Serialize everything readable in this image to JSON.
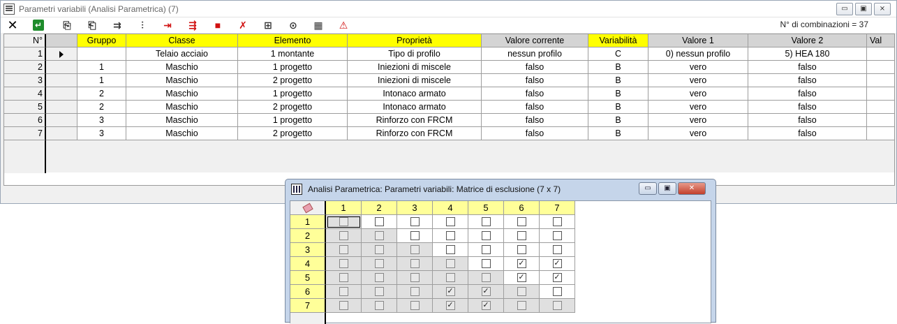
{
  "main_window": {
    "title": "Parametri variabili (Analisi Parametrica) (7)",
    "buttons": {
      "minimize": "▭",
      "restore": "▣",
      "close": "⨯"
    },
    "combinations_label": "N° di combinazioni = 37"
  },
  "toolbar": [
    {
      "icon": "close-icon",
      "glyph": "✕"
    },
    {
      "icon": "confirm-icon",
      "glyph": "↵"
    },
    {
      "icon": "copy-icon",
      "glyph": "⎘"
    },
    {
      "icon": "paste-icon",
      "glyph": "⎗"
    },
    {
      "icon": "insert-row-icon",
      "glyph": "⇉"
    },
    {
      "icon": "insert-rows-icon",
      "glyph": "⫶"
    },
    {
      "icon": "add-param-icon",
      "glyph": "⇥"
    },
    {
      "icon": "add-params-icon",
      "glyph": "⇶"
    },
    {
      "icon": "delete-icon",
      "glyph": "■"
    },
    {
      "icon": "remove-icon",
      "glyph": "✗"
    },
    {
      "icon": "matrix-icon",
      "glyph": "⊞"
    },
    {
      "icon": "check-icon",
      "glyph": "⊙"
    },
    {
      "icon": "run-icon",
      "glyph": "▦"
    },
    {
      "icon": "warning-icon",
      "glyph": "⚠"
    }
  ],
  "table": {
    "headers": [
      "N°",
      "",
      "Gruppo",
      "Classe",
      "Elemento",
      "Proprietà",
      "Valore corrente",
      "Variabilità",
      "Valore 1",
      "Valore 2",
      "Val"
    ],
    "rows": [
      [
        "1",
        "",
        "",
        "Telaio acciaio",
        "1 montante",
        "Tipo di profilo",
        "nessun profilo",
        "C",
        "0) nessun profilo",
        "5) HEA 180",
        ""
      ],
      [
        "2",
        "",
        "1",
        "Maschio",
        "1 progetto",
        "Iniezioni di miscele",
        "falso",
        "B",
        "vero",
        "falso",
        ""
      ],
      [
        "3",
        "",
        "1",
        "Maschio",
        "2 progetto",
        "Iniezioni di miscele",
        "falso",
        "B",
        "vero",
        "falso",
        ""
      ],
      [
        "4",
        "",
        "2",
        "Maschio",
        "1 progetto",
        "Intonaco armato",
        "falso",
        "B",
        "vero",
        "falso",
        ""
      ],
      [
        "5",
        "",
        "2",
        "Maschio",
        "2 progetto",
        "Intonaco armato",
        "falso",
        "B",
        "vero",
        "falso",
        ""
      ],
      [
        "6",
        "",
        "3",
        "Maschio",
        "1 progetto",
        "Rinforzo con FRCM",
        "falso",
        "B",
        "vero",
        "falso",
        ""
      ],
      [
        "7",
        "",
        "3",
        "Maschio",
        "2 progetto",
        "Rinforzo con FRCM",
        "falso",
        "B",
        "vero",
        "falso",
        ""
      ]
    ],
    "current_row": 1
  },
  "matrix_window": {
    "title": "Analisi Parametrica: Parametri variabili: Matrice di esclusione (7 x 7)",
    "col_headers": [
      "1",
      "2",
      "3",
      "4",
      "5",
      "6",
      "7"
    ],
    "row_headers": [
      "1",
      "2",
      "3",
      "4",
      "5",
      "6",
      "7"
    ],
    "checked": [
      [
        4,
        6
      ],
      [
        4,
        7
      ],
      [
        5,
        6
      ],
      [
        5,
        7
      ],
      [
        6,
        4
      ],
      [
        6,
        5
      ],
      [
        7,
        4
      ],
      [
        7,
        5
      ]
    ],
    "check_glyph": "✓"
  }
}
